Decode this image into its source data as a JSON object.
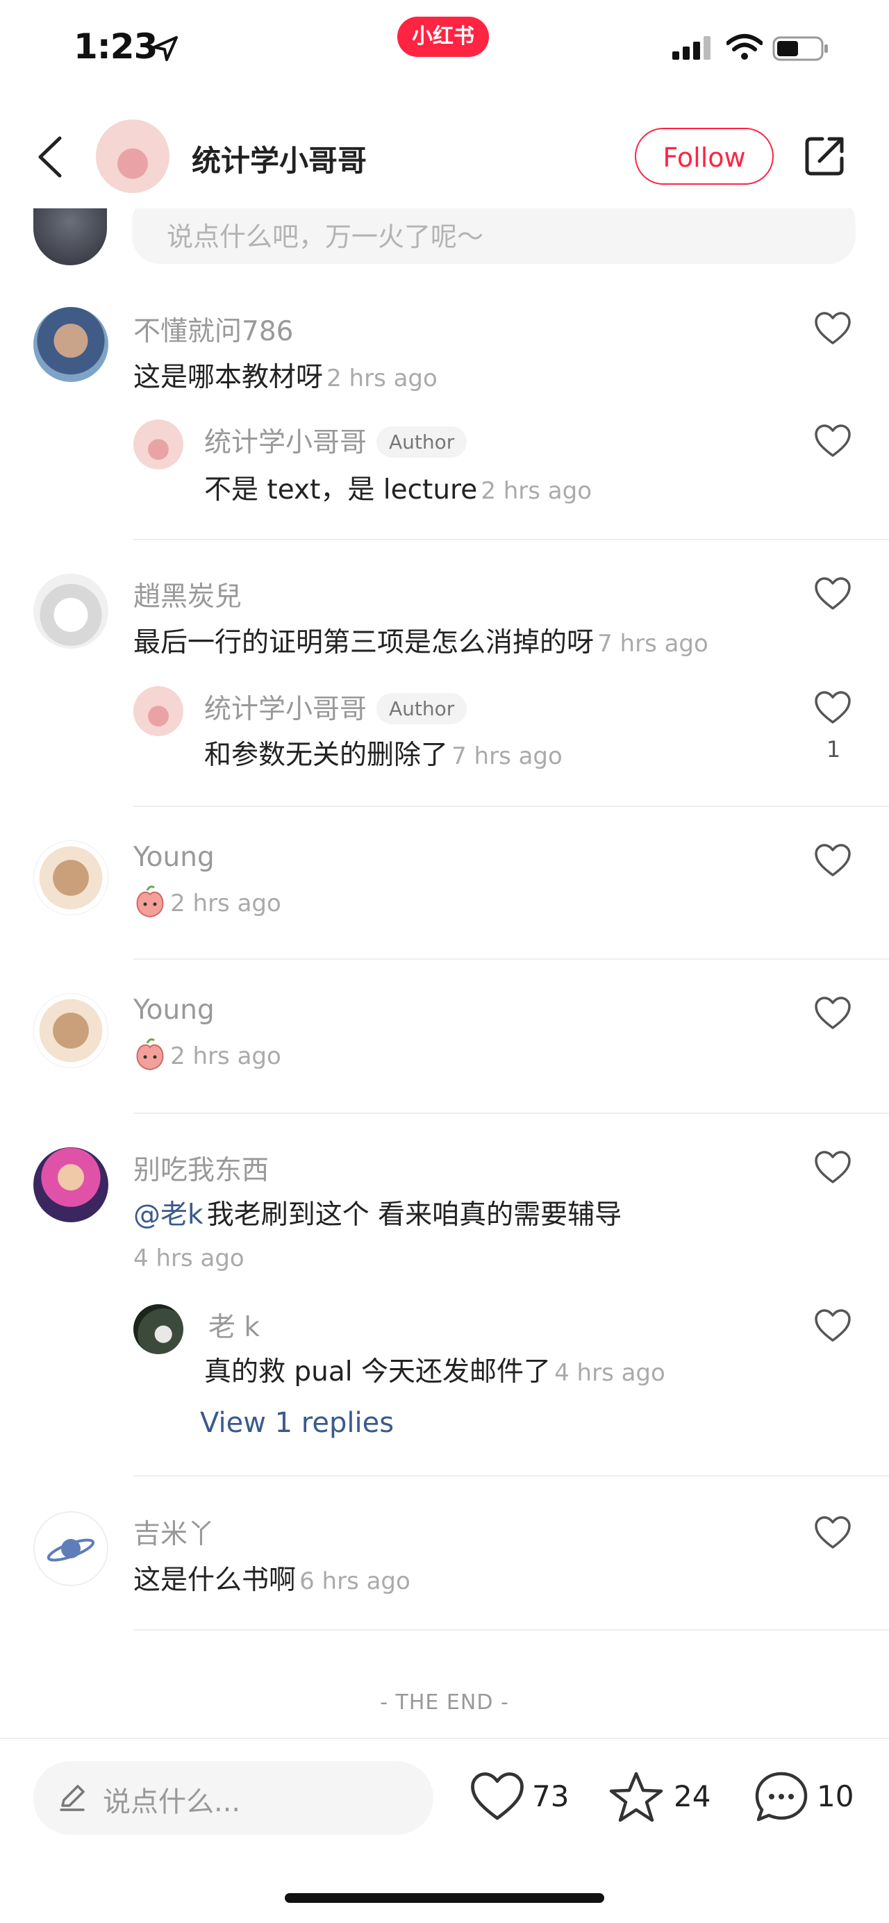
{
  "status_bar": {
    "time": "1:23",
    "brand": "小红书"
  },
  "header": {
    "author_name": "统计学小哥哥",
    "follow_label": "Follow"
  },
  "top_input": {
    "placeholder": "说点什么吧，万一火了呢～"
  },
  "comments": [
    {
      "user": "不懂就问786",
      "text": "这是哪本教材呀",
      "time": "2 hrs ago",
      "reply": {
        "user": "统计学小哥哥",
        "tag": "Author",
        "text": "不是 text，是 lecture",
        "time": "2 hrs ago"
      }
    },
    {
      "user": "趙黑炭兒",
      "text": "最后一行的证明第三项是怎么消掉的呀",
      "time": "7 hrs ago",
      "reply": {
        "user": "统计学小哥哥",
        "tag": "Author",
        "text": "和参数无关的删除了",
        "time": "7 hrs ago",
        "likes": "1"
      }
    },
    {
      "user": "Young",
      "time": "2 hrs ago"
    },
    {
      "user": "Young",
      "time": "2 hrs ago"
    },
    {
      "user": "别吃我东西",
      "mention": "@老k",
      "text": "我老刷到这个 看来咱真的需要辅导",
      "time": "4 hrs ago",
      "reply": {
        "user": "老 k",
        "text": "真的救 pual 今天还发邮件了",
        "time": "4 hrs ago"
      },
      "view_replies": "View 1 replies"
    },
    {
      "user": "吉米丫",
      "text": "这是什么书啊",
      "time": "6 hrs ago"
    }
  ],
  "end_label": "- THE END -",
  "bottom_bar": {
    "placeholder": "说点什么...",
    "likes": "73",
    "collects": "24",
    "comments": "10"
  },
  "colors": {
    "accent": "#ff2442",
    "link": "#3a5a8c"
  }
}
